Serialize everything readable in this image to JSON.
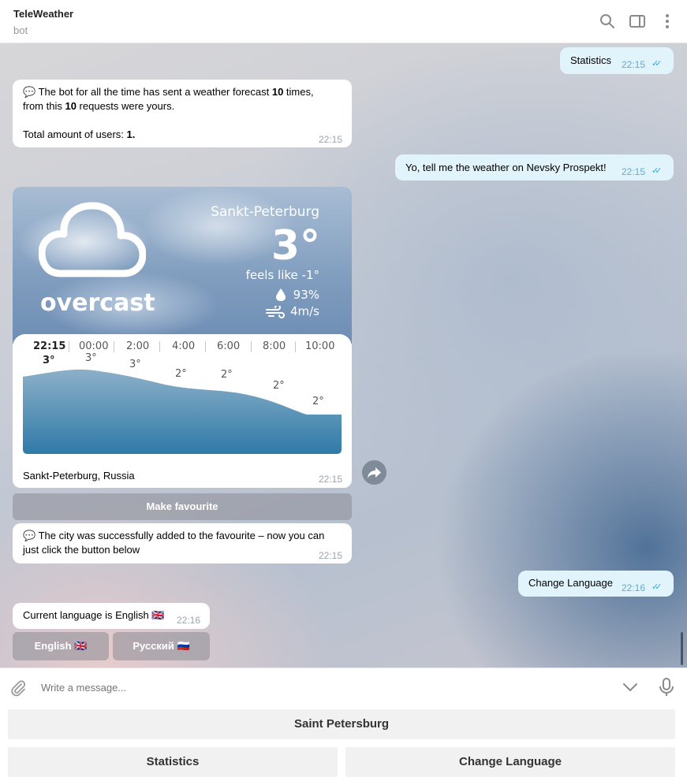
{
  "header": {
    "title": "TeleWeather",
    "subtitle": "bot"
  },
  "messages": {
    "m1": {
      "text": "Statistics",
      "time": "22:15"
    },
    "m2": {
      "line1_a": "The bot for all the time has sent a weather forecast ",
      "line1_b": "10",
      "line1_c": " times,",
      "line2_a": "from this ",
      "line2_b": "10",
      "line2_c": " requests were yours.",
      "line3_a": "Total amount of users: ",
      "line3_b": "1.",
      "time": "22:15"
    },
    "m3": {
      "text": "Yo, tell me the weather on Nevsky Prospekt!",
      "time": "22:15"
    },
    "m4": {
      "caption": "Sankt-Peterburg, Russia",
      "time": "22:15",
      "inline_button": "Make favourite"
    },
    "m5": {
      "line1": "The city was successfully added to the favourite – now you can",
      "line2": "just click the button below",
      "time": "22:15"
    },
    "m6": {
      "text": "Change Language",
      "time": "22:16"
    },
    "m7": {
      "text": "Current language is English 🇬🇧",
      "time": "22:16",
      "btn_en": "English 🇬🇧",
      "btn_ru": "Русский 🇷🇺"
    }
  },
  "weather": {
    "city": "Sankt-Peterburg",
    "temp": "3°",
    "feels_like": "feels like -1°",
    "humidity": "93%",
    "wind": "4m/s",
    "condition": "overcast",
    "hours": [
      "22:15",
      "00:00",
      "2:00",
      "4:00",
      "6:00",
      "8:00",
      "10:00"
    ],
    "temps": [
      "3°",
      "3°",
      "3°",
      "2°",
      "2°",
      "2°",
      "2°"
    ]
  },
  "input": {
    "placeholder": "Write a message..."
  },
  "keyboard": {
    "row1": "Saint Petersburg",
    "row2_left": "Statistics",
    "row2_right": "Change Language"
  }
}
